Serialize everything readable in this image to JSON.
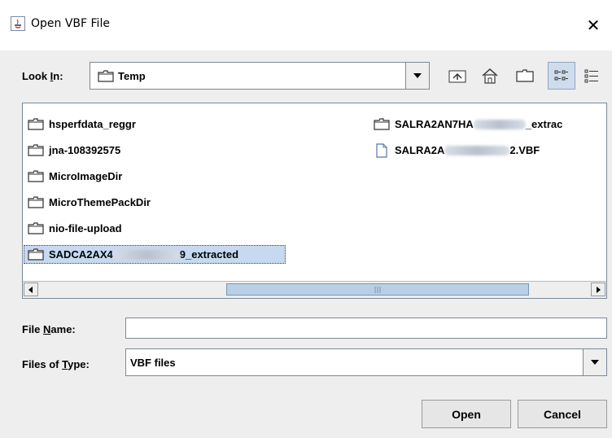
{
  "window": {
    "title": "Open VBF File",
    "close_glyph": "✕"
  },
  "lookin": {
    "label_pre": "Look ",
    "label_mnemonic": "I",
    "label_post": "n:",
    "value": "Temp",
    "toolbar_icons": [
      "up-one-level-icon",
      "home-icon",
      "new-folder-icon",
      "list-view-icon",
      "details-view-icon"
    ],
    "selected_view": "list-view"
  },
  "files": {
    "col1": [
      {
        "name": "hsperfdata_reggr",
        "type": "folder"
      },
      {
        "name": "jna-108392575",
        "type": "folder"
      },
      {
        "name": "MicroImageDir",
        "type": "folder"
      },
      {
        "name": "MicroThemePackDir",
        "type": "folder"
      },
      {
        "name": "nio-file-upload",
        "type": "folder"
      },
      {
        "name_pre": "SADCA2AX4",
        "name_post": "9_extracted",
        "type": "folder",
        "selected": true
      }
    ],
    "col2": [
      {
        "name_pre": "SALRA2AN7HA",
        "name_post": "_extrac",
        "type": "folder"
      },
      {
        "name_pre": "SALRA2A",
        "name_post": "2.VBF",
        "type": "file"
      }
    ]
  },
  "filename": {
    "label_pre": "File ",
    "label_mnemonic": "N",
    "label_post": "ame:",
    "value": ""
  },
  "filetype": {
    "label_pre": "Files of ",
    "label_mnemonic": "T",
    "label_post": "ype:",
    "value": "VBF files"
  },
  "buttons": {
    "open": "Open",
    "cancel": "Cancel"
  },
  "colors": {
    "selection": "#c6d9f0",
    "scroll_thumb": "#b8cfe5",
    "border": "#7a8a99"
  }
}
